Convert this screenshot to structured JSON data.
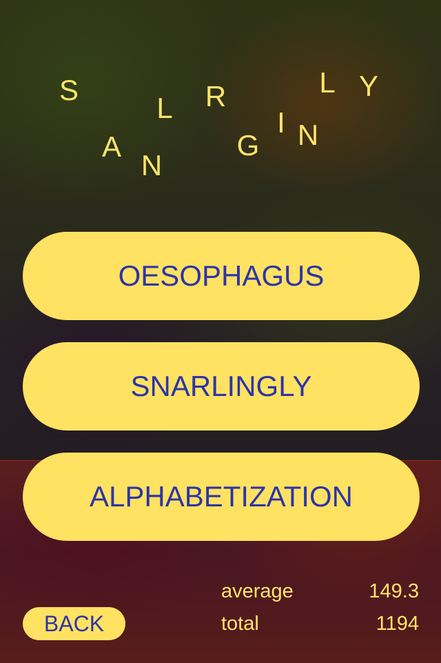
{
  "scrambled_letters": [
    "S",
    "A",
    "N",
    "L",
    "R",
    "G",
    "I",
    "N",
    "L",
    "Y"
  ],
  "choices": [
    "OESOPHAGUS",
    "SNARLINGLY",
    "ALPHABETIZATION"
  ],
  "back_label": "BACK",
  "stats": {
    "average_label": "average",
    "average_value": "149.3",
    "total_label": "total",
    "total_value": "1194"
  },
  "colors": {
    "button_fill": "#ffe262",
    "button_text": "#2e34a8",
    "letter_color": "#ffe46c",
    "bottom_panel": "#4a1623"
  }
}
